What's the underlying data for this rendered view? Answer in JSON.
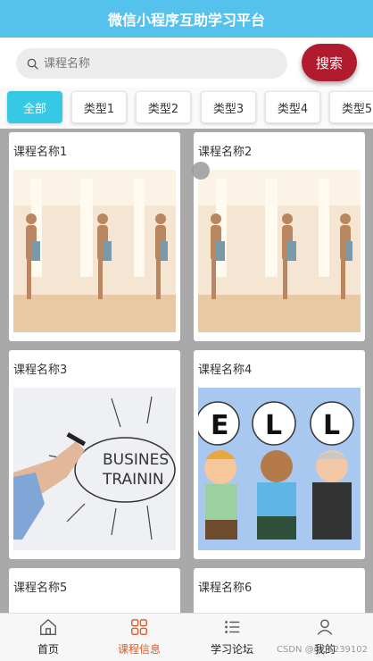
{
  "header": {
    "title": "微信小程序互助学习平台"
  },
  "search": {
    "placeholder": "课程名称",
    "button_label": "搜索"
  },
  "categories": [
    {
      "label": "全部",
      "active": true
    },
    {
      "label": "类型1",
      "active": false
    },
    {
      "label": "类型2",
      "active": false
    },
    {
      "label": "类型3",
      "active": false
    },
    {
      "label": "类型4",
      "active": false
    },
    {
      "label": "类型5",
      "active": false
    }
  ],
  "courses": [
    {
      "title": "课程名称1",
      "image": "yoga-class-photo"
    },
    {
      "title": "课程名称2",
      "image": "yoga-class-photo"
    },
    {
      "title": "课程名称3",
      "image": "business-training-whiteboard"
    },
    {
      "title": "课程名称4",
      "image": "cartoon-people-letters-ell"
    },
    {
      "title": "课程名称5",
      "image": ""
    },
    {
      "title": "课程名称6",
      "image": ""
    }
  ],
  "business_image_text": {
    "line1": "BUSINES",
    "line2": "TRAININ"
  },
  "ell_image_letters": [
    "E",
    "L",
    "L"
  ],
  "tabbar": [
    {
      "label": "首页",
      "icon": "home-icon",
      "active": false
    },
    {
      "label": "课程信息",
      "icon": "grid-icon",
      "active": true
    },
    {
      "label": "学习论坛",
      "icon": "list-icon",
      "active": false
    },
    {
      "label": "我的",
      "icon": "user-icon",
      "active": false
    }
  ],
  "watermark": "CSDN @QQ1239102",
  "colors": {
    "header": "#55c1ed",
    "search_button": "#b01b2e",
    "active_tab": "#36c9e6",
    "tabbar_active": "#e05a2a"
  }
}
